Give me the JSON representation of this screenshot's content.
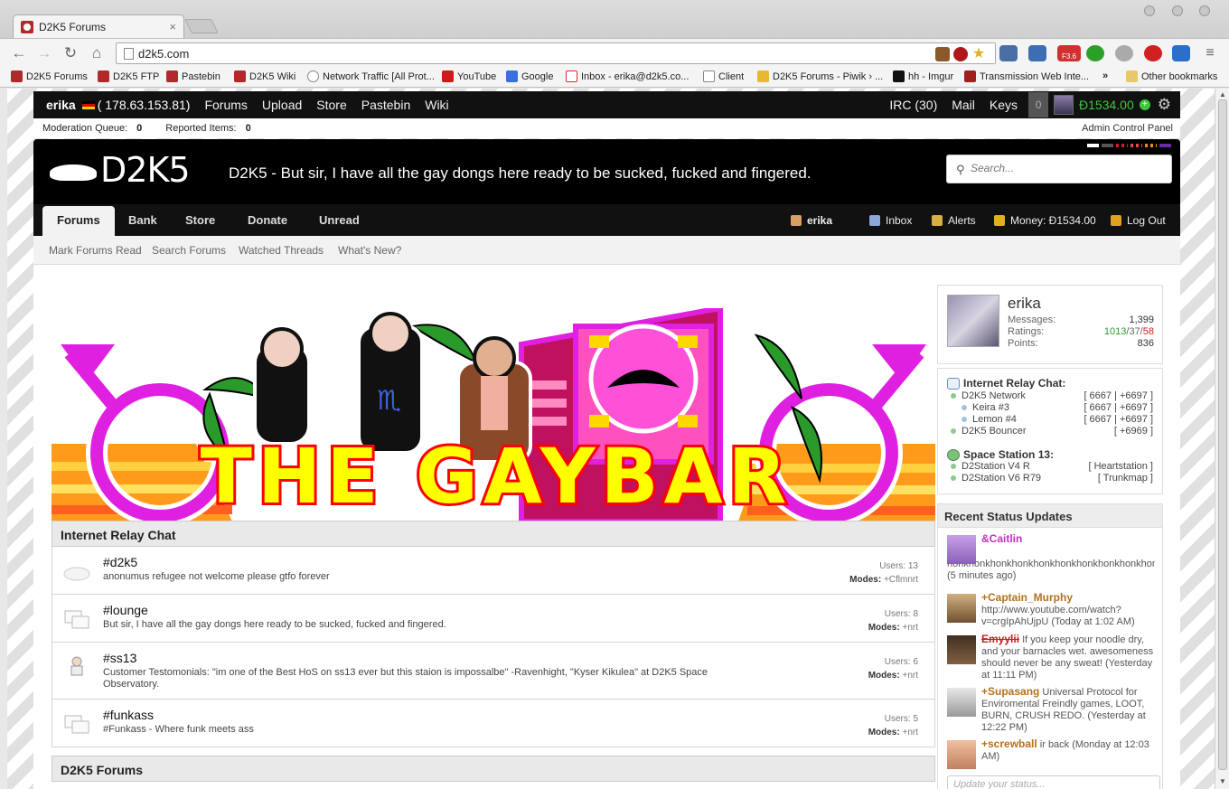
{
  "browser": {
    "tab_title": "D2K5 Forums",
    "tab_close": "×",
    "url": "d2k5.com",
    "bookmarks": [
      "D2K5 Forums",
      "D2K5 FTP",
      "Pastebin",
      "D2K5 Wiki",
      "Network Traffic [All Prot...",
      "YouTube",
      "Google",
      "Inbox - erika@d2k5.co...",
      "Client",
      "D2K5 Forums - Piwik › ...",
      "hh - Imgur",
      "Transmission Web Inte..."
    ],
    "bookmarks_more": "»",
    "other_bookmarks": "Other bookmarks",
    "ext_badge": "F3.6"
  },
  "topbar": {
    "user": "erika",
    "ip": "(  178.63.153.81)",
    "links": [
      "Forums",
      "Upload",
      "Store",
      "Pastebin",
      "Wiki"
    ],
    "irc": "IRC (30)",
    "mail": "Mail",
    "keys": "Keys",
    "count": "0",
    "money": "Đ1534.00"
  },
  "modbar": {
    "queue_label": "Moderation Queue:",
    "queue_value": "0",
    "reported_label": "Reported Items:",
    "reported_value": "0",
    "acp": "Admin Control Panel"
  },
  "header": {
    "logo": "D2K5",
    "tagline": "D2K5 - But sir, I have all the gay dongs here ready to be sucked, fucked and fingered.",
    "search_placeholder": "Search..."
  },
  "nav": {
    "tabs": [
      "Forums",
      "Bank",
      "Store",
      "Donate",
      "Unread"
    ],
    "user": "erika",
    "inbox": "Inbox",
    "alerts": "Alerts",
    "money": "Money: Đ1534.00",
    "logout": "Log Out"
  },
  "subnav": [
    "Mark Forums Read",
    "Search Forums",
    "Watched Threads",
    "What's New?"
  ],
  "banner": {
    "text": "THE GAYBAR"
  },
  "irc_section": {
    "title": "Internet Relay Chat",
    "channels": [
      {
        "name": "#d2k5",
        "desc": "anonumus refugee not welcome please gtfo forever",
        "users_label": "Users:",
        "users": "13",
        "modes_label": "Modes:",
        "modes": "+Cflmnrt"
      },
      {
        "name": "#lounge",
        "desc": "But sir, I have all the gay dongs here ready to be sucked, fucked and fingered.",
        "users_label": "Users:",
        "users": "8",
        "modes_label": "Modes:",
        "modes": "+nrt"
      },
      {
        "name": "#ss13",
        "desc": "Customer Testomonials: \"im one of the Best HoS on ss13 ever but this staion is impossalbe\" -Ravenhight, \"Kyser Kikulea\" at D2K5 Space Observatory.",
        "users_label": "Users:",
        "users": "6",
        "modes_label": "Modes:",
        "modes": "+nrt"
      },
      {
        "name": "#funkass",
        "desc": "#Funkass - Where funk meets ass",
        "users_label": "Users:",
        "users": "5",
        "modes_label": "Modes:",
        "modes": "+nrt"
      }
    ]
  },
  "forums_section": {
    "title": "D2K5 Forums"
  },
  "profile": {
    "name": "erika",
    "messages_label": "Messages:",
    "messages": "1,399",
    "ratings_label": "Ratings:",
    "ratings_pos": "1013",
    "ratings_neu": "/37/",
    "ratings_neg": "58",
    "points_label": "Points:",
    "points": "836"
  },
  "irc_sidebar": {
    "title": "Internet Relay Chat:",
    "rows": [
      {
        "name": "D2K5 Network",
        "ports": "[ 6667 | +6697 ]"
      },
      {
        "name": "Keira #3",
        "ports": "[ 6667 | +6697 ]"
      },
      {
        "name": "Lemon #4",
        "ports": "[ 6667 | +6697 ]"
      },
      {
        "name": "D2K5 Bouncer",
        "ports": "[ +6969 ]"
      }
    ],
    "ss13_title": "Space Station 13:",
    "ss13_rows": [
      {
        "name": "D2Station V4 R",
        "link": "[ Heartstation ]"
      },
      {
        "name": "D2Station V6 R79",
        "link": "[ Trunkmap ]"
      }
    ]
  },
  "status_updates": {
    "title": "Recent Status Updates",
    "items": [
      {
        "user": "&Caitlin",
        "text": "honkhonkhonkhonkhonkhonkhonkhonkhonkhonk",
        "time": "(5 minutes ago)"
      },
      {
        "user": "+Captain_Murphy",
        "text": "http://www.youtube.com/watch?v=crgIpAhUjpU (Today at 1:02 AM)"
      },
      {
        "user": "Emyylii",
        "text": "If you keep your noodle dry, and your barnacles wet. awesomeness should never be any sweat! (Yesterday at 11:11 PM)"
      },
      {
        "user": "+Supasang",
        "text": "Universal Protocol for Enviromental Freindly games, LOOT, BURN, CRUSH REDO. (Yesterday at 12:22 PM)"
      },
      {
        "user": "+screwball",
        "text": "ir back (Monday at 12:03 AM)"
      }
    ],
    "input_placeholder": "Update your status..."
  },
  "colors": {
    "page_bg": "#000000",
    "accent_pink": "#e020e0",
    "money_green": "#3ec83e",
    "status_orange": "#b5711c",
    "caitlin_purple": "#c030c0",
    "emyylii_red": "#c82020"
  }
}
